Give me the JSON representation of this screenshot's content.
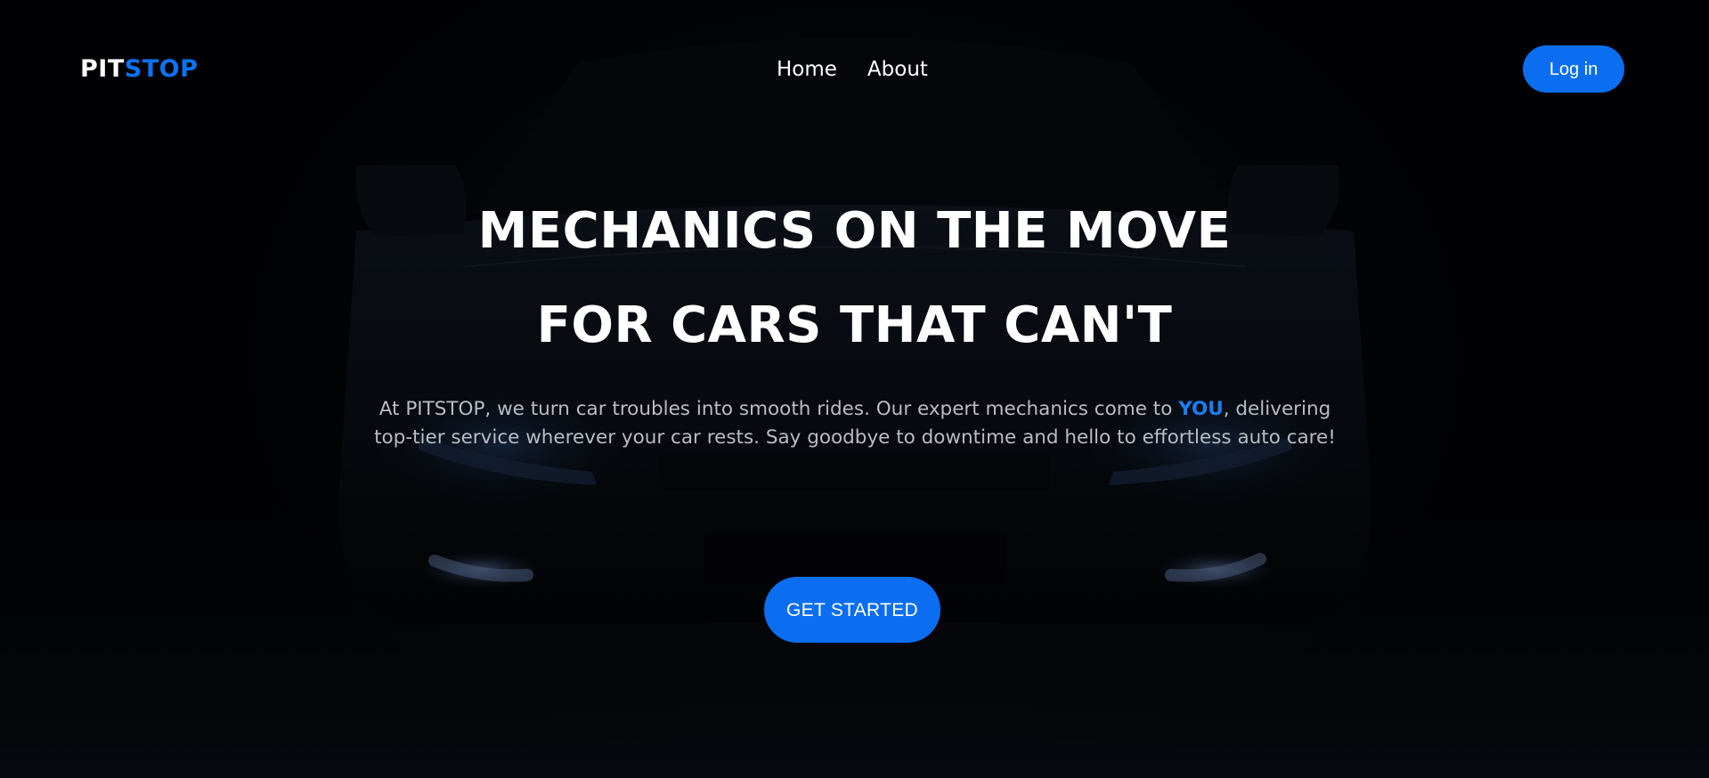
{
  "brand": {
    "logo_part1": "PIT",
    "logo_part2": "STOP",
    "accent_color": "#0b6ef0"
  },
  "nav": {
    "links": [
      {
        "label": "Home"
      },
      {
        "label": "About"
      }
    ],
    "login_label": "Log in"
  },
  "hero": {
    "headline_line1": "MECHANICS ON THE MOVE",
    "headline_line2": "FOR CARS THAT CAN'T",
    "description_before": "At PITSTOP, we turn car troubles into smooth rides. Our expert mechanics come to ",
    "description_highlight": "YOU",
    "description_after": ", delivering top-tier service wherever your car rests. Say goodbye to downtime and hello to effortless auto care!",
    "cta_label": "GET STARTED",
    "background_image": "car-front-silhouette"
  }
}
